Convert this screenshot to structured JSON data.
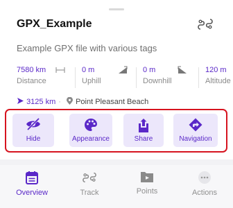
{
  "header": {
    "title": "GPX_Example",
    "subtitle": "Example GPX file with various tags"
  },
  "stats": [
    {
      "value": "7580 km",
      "label": "Distance",
      "icon": "distance-icon"
    },
    {
      "value": "0 m",
      "label": "Uphill",
      "icon": "uphill-icon"
    },
    {
      "value": "0 m",
      "label": "Downhill",
      "icon": "downhill-icon"
    },
    {
      "value": "120 m",
      "label": "Altitude",
      "icon": "altitude-icon"
    }
  ],
  "info": {
    "direction_distance": "3125 km",
    "separator": "·",
    "place": "Point Pleasant Beach"
  },
  "actions": [
    {
      "label": "Hide",
      "icon": "eye-off-icon"
    },
    {
      "label": "Appearance",
      "icon": "palette-icon"
    },
    {
      "label": "Share",
      "icon": "share-icon"
    },
    {
      "label": "Navigation",
      "icon": "navigation-icon"
    }
  ],
  "tabs": [
    {
      "label": "Overview",
      "icon": "overview-icon",
      "active": true
    },
    {
      "label": "Track",
      "icon": "track-icon",
      "active": false
    },
    {
      "label": "Points",
      "icon": "folder-icon",
      "active": false
    },
    {
      "label": "Actions",
      "icon": "more-icon",
      "active": false
    }
  ],
  "colors": {
    "accent": "#5a28c8",
    "action_bg": "#ece7fb",
    "highlight_border": "#d6131f",
    "muted_text": "#8a8a8a"
  }
}
